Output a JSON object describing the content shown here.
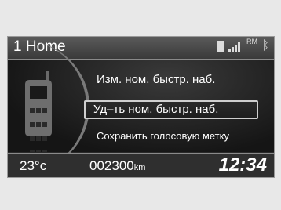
{
  "header": {
    "title": "1 Home",
    "network_label": "RM"
  },
  "menu": {
    "items": [
      {
        "label": "Изм. ном. быстр. наб."
      },
      {
        "label": "Уд–ть ном. быстр. наб."
      },
      {
        "label": "Сохранить голосовую метку"
      }
    ]
  },
  "footer": {
    "temperature": "23°c",
    "odometer_value": "002300",
    "odometer_unit": "km",
    "clock": "12:34"
  },
  "icons": [
    "battery-icon",
    "signal-icon",
    "bluetooth-icon",
    "phone-icon"
  ]
}
